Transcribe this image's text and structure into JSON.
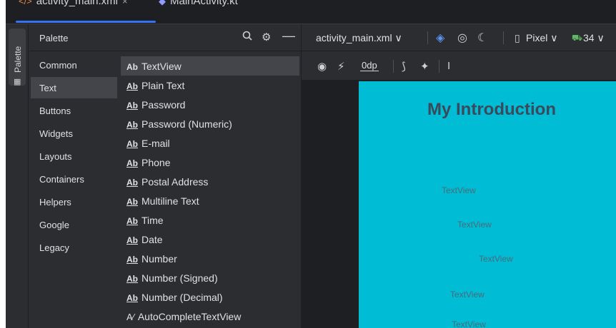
{
  "tabs": [
    {
      "label": "activity_main.xml",
      "icon": "xml-file-icon",
      "close": "×"
    },
    {
      "label": "MainActivity.kt",
      "icon": "kotlin-file-icon"
    }
  ],
  "tool_window_stripe": {
    "label": "Palette",
    "icon": "palette-icon"
  },
  "palette": {
    "title": "Palette",
    "categories": [
      {
        "label": "Common"
      },
      {
        "label": "Text",
        "selected": true
      },
      {
        "label": "Buttons"
      },
      {
        "label": "Widgets"
      },
      {
        "label": "Layouts"
      },
      {
        "label": "Containers"
      },
      {
        "label": "Helpers"
      },
      {
        "label": "Google"
      },
      {
        "label": "Legacy"
      }
    ],
    "items": [
      {
        "icon": "Ab",
        "label": "TextView",
        "selected": true
      },
      {
        "icon": "Ab",
        "label": "Plain Text"
      },
      {
        "icon": "Ab",
        "label": "Password"
      },
      {
        "icon": "Ab",
        "label": "Password (Numeric)"
      },
      {
        "icon": "Ab",
        "label": "E-mail"
      },
      {
        "icon": "Ab",
        "label": "Phone"
      },
      {
        "icon": "Ab",
        "label": "Postal Address"
      },
      {
        "icon": "Ab",
        "label": "Multiline Text"
      },
      {
        "icon": "Ab",
        "label": "Time"
      },
      {
        "icon": "Ab",
        "label": "Date"
      },
      {
        "icon": "Ab",
        "label": "Number"
      },
      {
        "icon": "Ab",
        "label": "Number (Signed)"
      },
      {
        "icon": "Ab",
        "label": "Number (Decimal)"
      },
      {
        "icon": "A⁄",
        "label": "AutoCompleteTextView"
      }
    ]
  },
  "editor_toolbar": {
    "file_label": "activity_main.xml ∨",
    "device_label": "Pixel ∨",
    "api_label": "34 ∨",
    "margin_label": "0dp"
  },
  "design": {
    "title": "My Introduction",
    "textviews": [
      "TextView",
      "TextView",
      "TextView",
      "TextView",
      "TextView"
    ],
    "background_color": "#00bcd4"
  }
}
